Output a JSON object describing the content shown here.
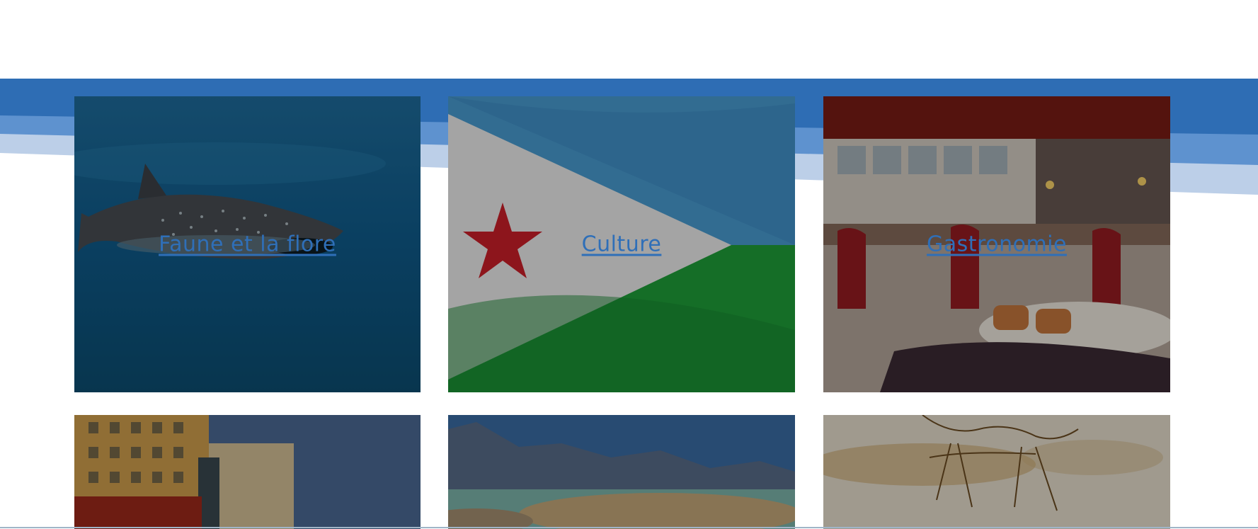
{
  "colors": {
    "band_dark": "#2e6db4",
    "band_mid": "#5b8fcc",
    "band_light": "#b9cee8",
    "link": "#2f6fb8"
  },
  "tiles": [
    {
      "label": "Faune et la flore",
      "image": "whale-shark-underwater"
    },
    {
      "label": "Culture",
      "image": "djibouti-flag"
    },
    {
      "label": "Gastronomie",
      "image": "restaurant-interior"
    },
    {
      "label": "",
      "image": "hotel-building"
    },
    {
      "label": "",
      "image": "lake-landscape"
    },
    {
      "label": "",
      "image": "camel-sketch"
    }
  ]
}
